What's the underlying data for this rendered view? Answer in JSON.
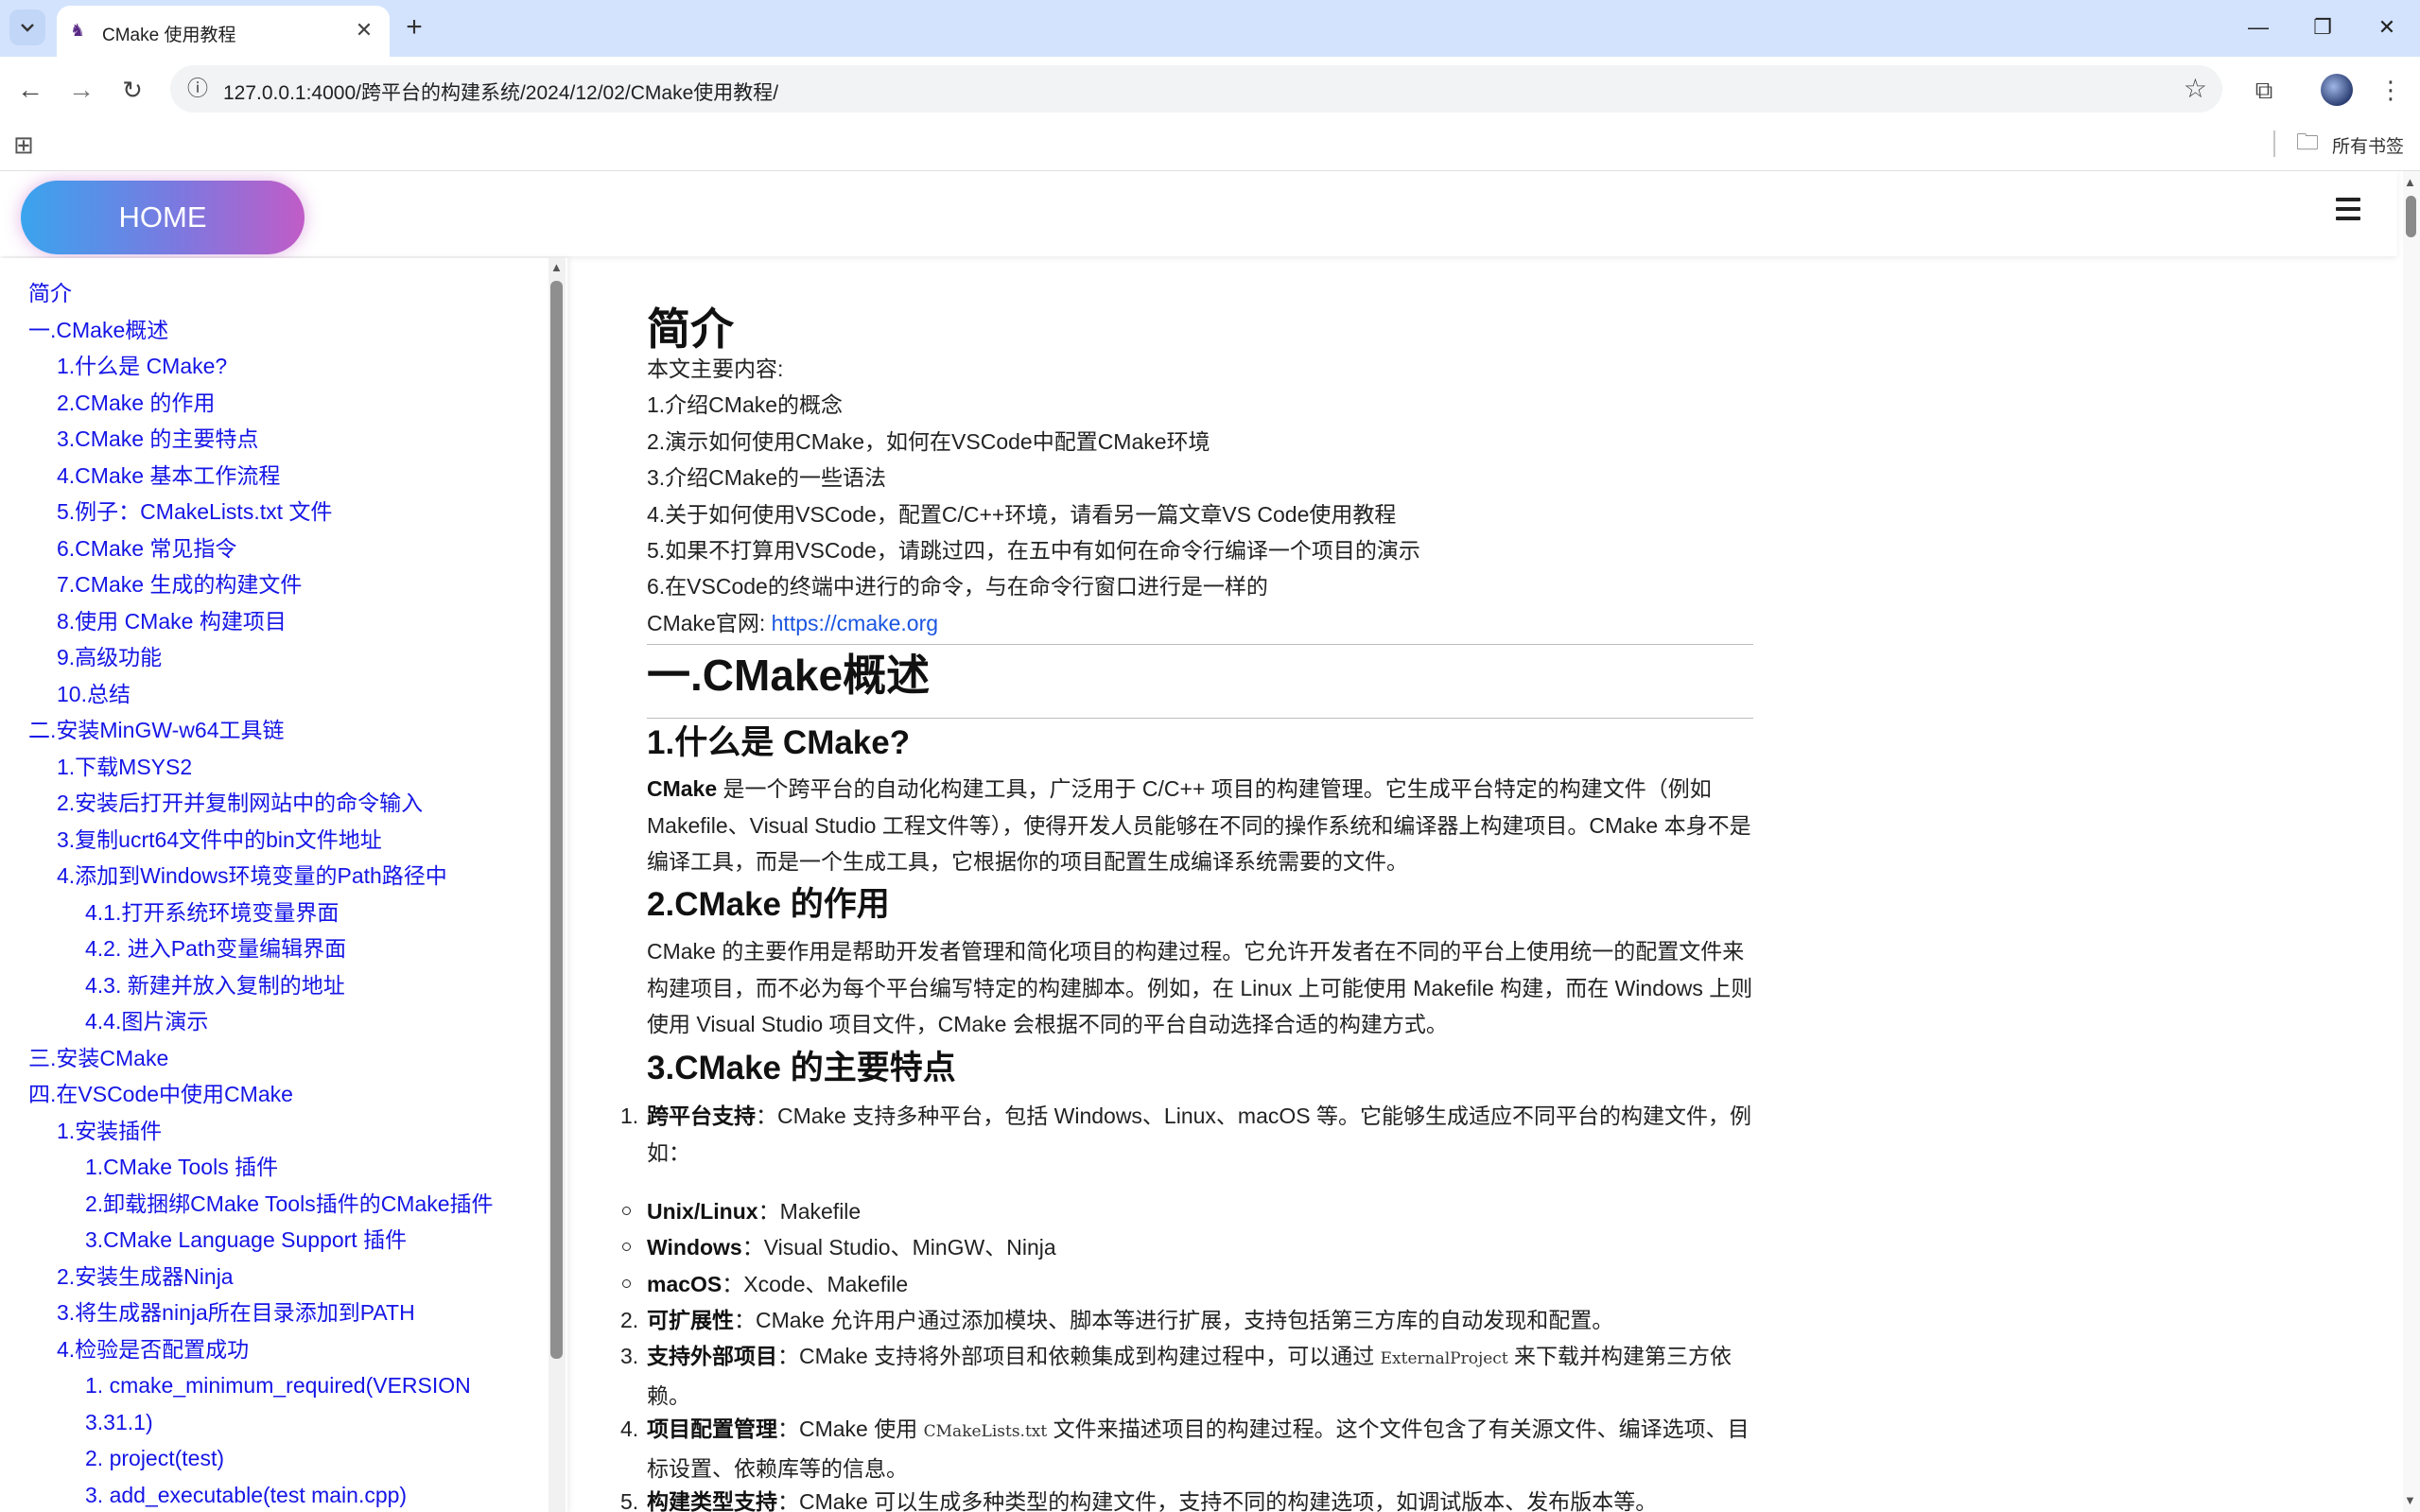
{
  "browser": {
    "tab_title": "CMake 使用教程",
    "url": "127.0.0.1:4000/跨平台的构建系统/2024/12/02/CMake使用教程/",
    "bookmarks_label": "所有书签"
  },
  "site": {
    "home_label": "HOME"
  },
  "toc": [
    "简介",
    "一.CMake概述",
    "1.什么是 CMake?",
    "2.CMake 的作用",
    "3.CMake 的主要特点",
    "4.CMake 基本工作流程",
    "5.例子：CMakeLists.txt 文件",
    "6.CMake 常见指令",
    "7.CMake 生成的构建文件",
    "8.使用 CMake 构建项目",
    "9.高级功能",
    "10.总结",
    "二.安装MinGW-w64工具链",
    "1.下载MSYS2",
    "2.安装后打开并复制网站中的命令输入",
    "3.复制ucrt64文件中的bin文件地址",
    "4.添加到Windows环境变量的Path路径中",
    "4.1.打开系统环境变量界面",
    "4.2. 进入Path变量编辑界面",
    "4.3. 新建并放入复制的地址",
    "4.4.图片演示",
    "三.安装CMake",
    "四.在VSCode中使用CMake",
    "1.安装插件",
    "1.CMake Tools 插件",
    "2.卸载捆绑CMake Tools插件的CMake插件",
    "3.CMake Language Support 插件",
    "2.安装生成器Ninja",
    "3.将生成器ninja所在目录添加到PATH",
    "4.检验是否配置成功",
    "1. cmake_minimum_required(VERSION",
    "3.31.1)",
    "2. project(test)",
    "3. add_executable(test main.cpp)"
  ],
  "article": {
    "intro_title": "简介",
    "intro_lines": [
      "本文主要内容:",
      "1.介绍CMake的概念",
      "2.演示如何使用CMake，如何在VSCode中配置CMake环境",
      "3.介绍CMake的一些语法",
      "4.关于如何使用VSCode，配置C/C++环境，请看另一篇文章VS Code使用教程",
      "5.如果不打算用VSCode，请跳过四，在五中有如何在命令行编译一个项目的演示",
      "6.在VSCode的终端中进行的命令，与在命令行窗口进行是一样的"
    ],
    "official_label": "CMake官网: ",
    "official_url": "https://cmake.org",
    "section1_title": "一.CMake概述",
    "s1_title": "1.什么是 CMake?",
    "s1_bold": "CMake",
    "s1_text": " 是一个跨平台的自动化构建工具，广泛用于 C/C++ 项目的构建管理。它生成平台特定的构建文件（例如 Makefile、Visual Studio 工程文件等），使得开发人员能够在不同的操作系统和编译器上构建项目。CMake 本身不是编译工具，而是一个生成工具，它根据你的项目配置生成编译系统需要的文件。",
    "s2_title": "2.CMake 的作用",
    "s2_text": "CMake 的主要作用是帮助开发者管理和简化项目的构建过程。它允许开发者在不同的平台上使用统一的配置文件来构建项目，而不必为每个平台编写特定的构建脚本。例如，在 Linux 上可能使用 Makefile 构建，而在 Windows 上则使用 Visual Studio 项目文件，CMake 会根据不同的平台自动选择合适的构建方式。",
    "s3_title": "3.CMake 的主要特点",
    "features": [
      {
        "num": "1.",
        "bold": "跨平台支持",
        "text": "：CMake 支持多种平台，包括 Windows、Linux、macOS 等。它能够生成适应不同平台的构建文件，例如："
      },
      {
        "num": "2.",
        "bold": "可扩展性",
        "text": "：CMake 允许用户通过添加模块、脚本等进行扩展，支持包括第三方库的自动发现和配置。"
      },
      {
        "num": "3.",
        "bold": "支持外部项目",
        "text": "：CMake 支持将外部项目和依赖集成到构建过程中，可以通过 ",
        "code": "ExternalProject",
        "text2": " 来下载并构建第三方依赖。"
      },
      {
        "num": "4.",
        "bold": "项目配置管理",
        "text": "：CMake 使用 ",
        "code": "CMakeLists.txt",
        "text2": " 文件来描述项目的构建过程。这个文件包含了有关源文件、编译选项、目标设置、依赖库等的信息。"
      },
      {
        "num": "5.",
        "bold": "构建类型支持",
        "text": "：CMake 可以生成多种类型的构建文件，支持不同的构建选项，如调试版本、发布版本等。"
      }
    ],
    "platforms": [
      {
        "bold": "Unix/Linux",
        "text": "：Makefile"
      },
      {
        "bold": "Windows",
        "text": "：Visual Studio、MinGW、Ninja"
      },
      {
        "bold": "macOS",
        "text": "：Xcode、Makefile"
      }
    ]
  }
}
